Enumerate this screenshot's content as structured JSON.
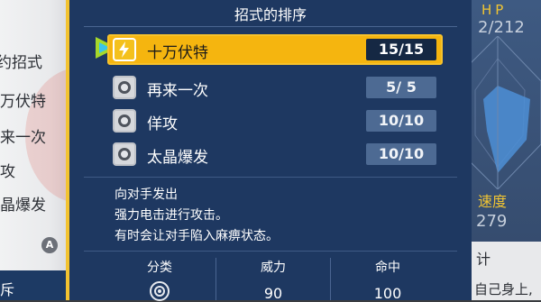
{
  "background_left": {
    "items": [
      "约招式",
      "万伏特",
      "来一次",
      "攻",
      "晶爆发"
    ],
    "button_hint": "A",
    "bottom_text": "斥"
  },
  "background_right": {
    "hp_label": "HP",
    "hp_value": "2/212",
    "speed_label": "速度",
    "speed_value": "279",
    "lower_text_1": "计",
    "lower_text_2": "自己身上,"
  },
  "panel": {
    "title": "招式的排序",
    "moves": [
      {
        "name": "十万伏特",
        "pp": "15/15",
        "type_icon": "electric-type-icon",
        "selected": true
      },
      {
        "name": "再来一次",
        "pp": "5/ 5",
        "type_icon": "normal-type-icon",
        "selected": false
      },
      {
        "name": "佯攻",
        "pp": "10/10",
        "type_icon": "normal-type-icon",
        "selected": false
      },
      {
        "name": "太晶爆发",
        "pp": "10/10",
        "type_icon": "normal-type-icon",
        "selected": false
      }
    ],
    "description": [
      "向对手发出",
      "强力电击进行攻击。",
      "有时会让对手陷入麻痹状态。"
    ],
    "stats": {
      "category_label": "分类",
      "category_icon": "special-category-icon",
      "power_label": "威力",
      "power_value": "90",
      "accuracy_label": "命中",
      "accuracy_value": "100"
    }
  },
  "colors": {
    "panel_bg": "#1e3861",
    "accent_yellow": "#f5b50f",
    "pp_box": "#4d6a93",
    "cursor_green": "#a6d92b",
    "cursor_cyan": "#3cc5e8"
  }
}
